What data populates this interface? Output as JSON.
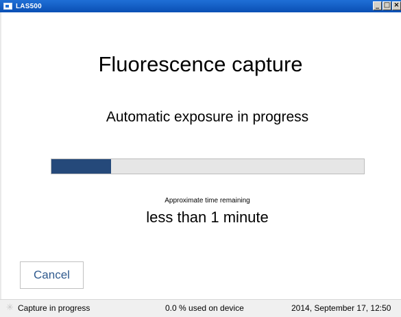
{
  "window": {
    "title": "LAS500",
    "minimize": "_",
    "maximize": "□",
    "close": "×"
  },
  "main": {
    "heading": "Fluorescence capture",
    "status": "Automatic exposure in progress",
    "progress_fraction": 0.19,
    "time_label": "Approximate time remaining",
    "time_value": "less than 1 minute",
    "cancel_label": "Cancel"
  },
  "statusbar": {
    "spinner_icon": "spinner-icon",
    "capture_status": "Capture in progress",
    "device_usage": "0.0 % used on device",
    "datetime": "2014, September 17, 12:50"
  },
  "colors": {
    "titlebar": "#0a4fb4",
    "progress_fill": "#25497a",
    "cancel_text": "#2f5a8e"
  }
}
